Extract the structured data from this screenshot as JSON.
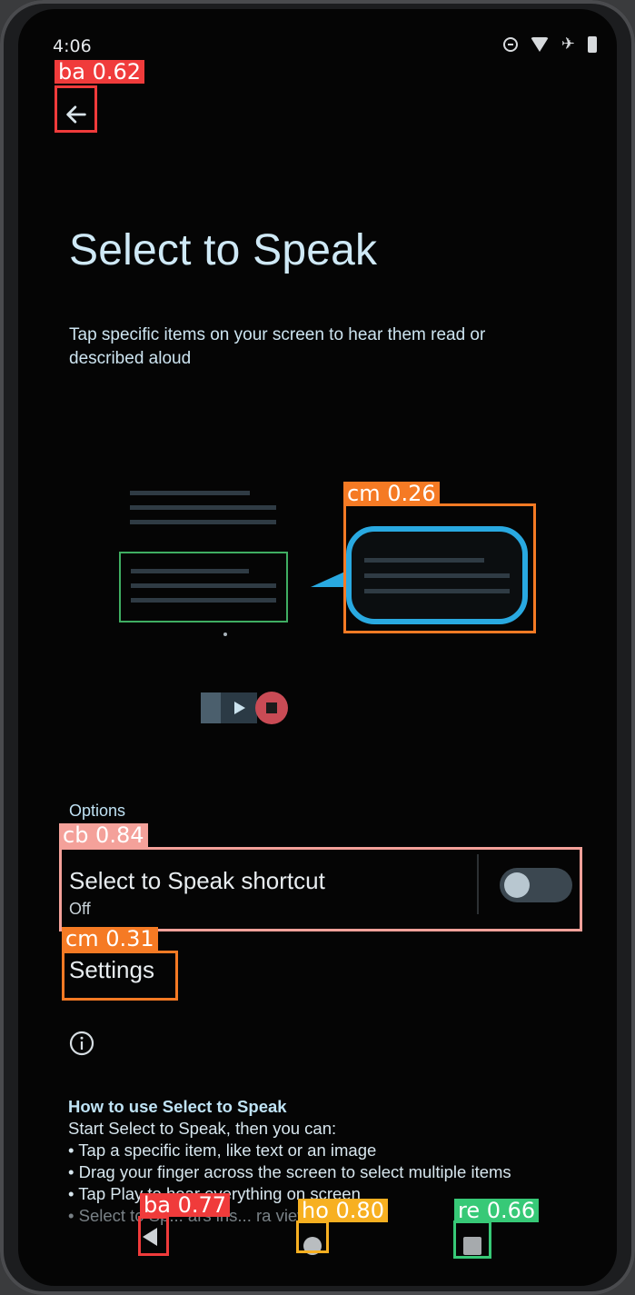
{
  "status_bar": {
    "time": "4:06",
    "icons": [
      "do-not-disturb-icon",
      "wifi-icon",
      "airplane-icon",
      "battery-icon"
    ]
  },
  "header": {
    "back_icon": "arrow-left-icon"
  },
  "main": {
    "title": "Select to Speak",
    "description": "Tap specific items on your screen to hear them read or described aloud"
  },
  "options": {
    "section_label": "Options",
    "shortcut_title": "Select to Speak shortcut",
    "shortcut_state": "Off",
    "shortcut_enabled": false,
    "settings_label": "Settings"
  },
  "howto": {
    "heading": "How to use Select to Speak",
    "intro": "Start Select to Speak, then you can:",
    "bullets": [
      "• Tap a specific item, like text or an image",
      "• Drag your finger across the screen to select multiple items",
      "• Tap Play to hear everything on screen",
      "• Select to Sp... ars ins... ra view"
    ]
  },
  "overlay_labels": {
    "back": "ba 0.62",
    "speech_bubble": "cm 0.26",
    "shortcut_row": "cb 0.84",
    "settings": "cm 0.31",
    "nav_back": "ba 0.77",
    "nav_home": "ho 0.80",
    "nav_recent": "re 0.66"
  },
  "colors": {
    "accent": "#29a9e1",
    "label_red": "#f03b3b",
    "label_orange": "#f57a24",
    "label_pink": "#f4a19a",
    "label_yellow": "#f7b021",
    "label_green": "#37c977",
    "background": "#050505"
  },
  "navbar": {
    "icons": [
      "nav-back-icon",
      "nav-home-icon",
      "nav-recent-icon"
    ]
  }
}
